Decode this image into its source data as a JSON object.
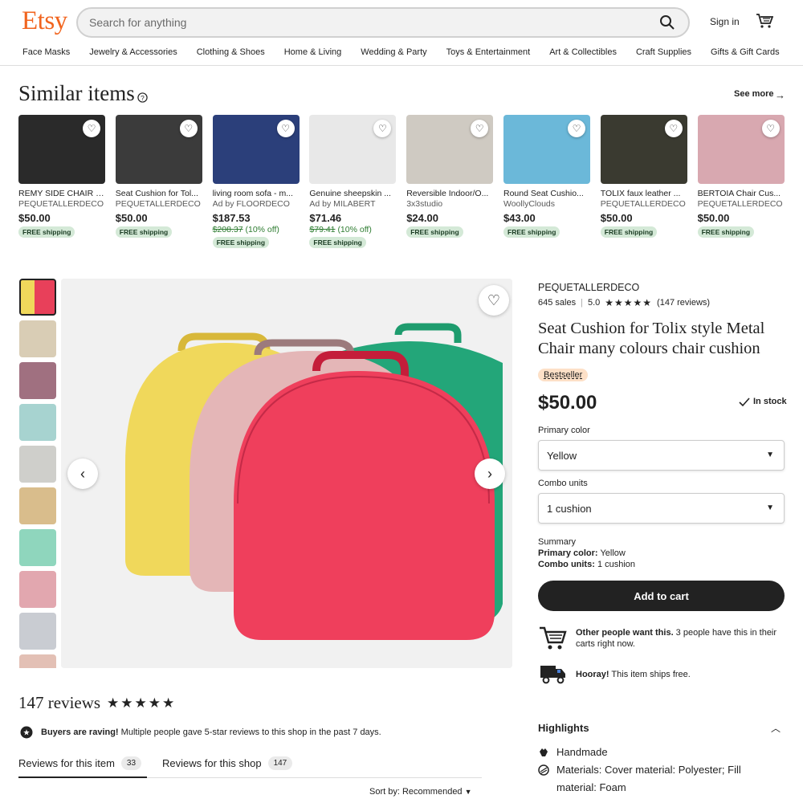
{
  "header": {
    "logo": "Etsy",
    "search_placeholder": "Search for anything",
    "sign_in": "Sign in",
    "nav": [
      "Face Masks",
      "Jewelry & Accessories",
      "Clothing & Shoes",
      "Home & Living",
      "Wedding & Party",
      "Toys & Entertainment",
      "Art & Collectibles",
      "Craft Supplies",
      "Gifts & Gift Cards"
    ]
  },
  "similar": {
    "title": "Similar items",
    "see_more": "See more",
    "items": [
      {
        "title": "REMY SIDE CHAIR p...",
        "shop": "PEQUETALLERDECO",
        "price": "$50.00",
        "orig": "",
        "off": "",
        "badge": "FREE shipping",
        "color": "#2a2a2a"
      },
      {
        "title": "Seat Cushion for Tol...",
        "shop": "PEQUETALLERDECO",
        "price": "$50.00",
        "orig": "",
        "off": "",
        "badge": "FREE shipping",
        "color": "#3b3b3b"
      },
      {
        "title": "living room sofa - m...",
        "shop": "Ad by FLOORDECO",
        "price": "$187.53",
        "orig": "$208.37",
        "off": "(10% off)",
        "badge": "FREE shipping",
        "color": "#2b3f7a"
      },
      {
        "title": "Genuine sheepskin ...",
        "shop": "Ad by MILABERT",
        "price": "$71.46",
        "orig": "$79.41",
        "off": "(10% off)",
        "badge": "FREE shipping",
        "color": "#e8e8e8"
      },
      {
        "title": "Reversible Indoor/O...",
        "shop": "3x3studio",
        "price": "$24.00",
        "orig": "",
        "off": "",
        "badge": "FREE shipping",
        "color": "#cfcac2"
      },
      {
        "title": "Round Seat Cushio...",
        "shop": "WoollyClouds",
        "price": "$43.00",
        "orig": "",
        "off": "",
        "badge": "FREE shipping",
        "color": "#6bb8d9"
      },
      {
        "title": "TOLIX faux leather ...",
        "shop": "PEQUETALLERDECO",
        "price": "$50.00",
        "orig": "",
        "off": "",
        "badge": "FREE shipping",
        "color": "#3a3a30"
      },
      {
        "title": "BERTOIA Chair Cus...",
        "shop": "PEQUETALLERDECO",
        "price": "$50.00",
        "orig": "",
        "off": "",
        "badge": "FREE shipping",
        "color": "#d8a8b0"
      }
    ]
  },
  "gallery": {
    "thumb_colors": [
      "#e8405a",
      "#d9cdb5",
      "#a07080",
      "#a7d3d0",
      "#cfcfcb",
      "#d9bd8c",
      "#8fd6bd",
      "#e2a7af",
      "#c9ccd2",
      "#e3c0b5"
    ]
  },
  "product": {
    "shop": "PEQUETALLERDECO",
    "sales": "645 sales",
    "rating": "5.0",
    "reviews": "(147 reviews)",
    "title": "Seat Cushion for Tolix style Metal Chair many colours chair cushion",
    "badge": "Bestseller",
    "price": "$50.00",
    "stock": "In stock",
    "primary_color_label": "Primary color",
    "primary_color_value": "Yellow",
    "combo_label": "Combo units",
    "combo_value": "1 cushion",
    "summary_title": "Summary",
    "summary_color_key": "Primary color:",
    "summary_color_val": " Yellow",
    "summary_combo_key": "Combo units:",
    "summary_combo_val": " 1 cushion",
    "add_to_cart": "Add to cart",
    "info1_bold": "Other people want this.",
    "info1_text": " 3 people have this in their carts right now.",
    "info2_bold": "Hooray!",
    "info2_text": " This item ships free."
  },
  "reviews": {
    "title": "147 reviews",
    "raving_bold": "Buyers are raving!",
    "raving_text": " Multiple people gave 5-star reviews to this shop in the past 7 days.",
    "tab_item": "Reviews for this item",
    "tab_item_count": "33",
    "tab_shop": "Reviews for this shop",
    "tab_shop_count": "147",
    "sort": "Sort by: Recommended"
  },
  "highlights": {
    "title": "Highlights",
    "items": [
      "Handmade",
      "Materials: Cover material: Polyester; Fill material: Foam"
    ]
  }
}
